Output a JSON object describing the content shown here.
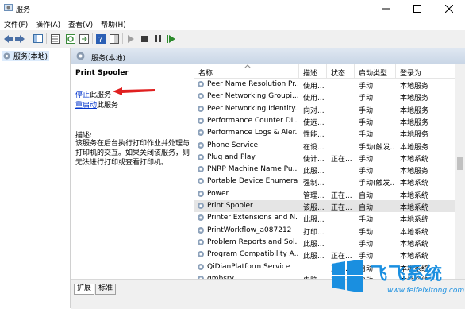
{
  "window": {
    "title": "服务"
  },
  "menu": {
    "file": "文件(F)",
    "action": "操作(A)",
    "view": "查看(V)",
    "help": "帮助(H)"
  },
  "tree": {
    "root": "服务(本地)"
  },
  "panel": {
    "header": "服务(本地)"
  },
  "detail": {
    "service_name": "Print Spooler",
    "stop_link": "停止",
    "stop_suffix": "此服务",
    "restart_link": "重启动",
    "restart_suffix": "此服务",
    "desc_label": "描述:",
    "desc_text": "该服务在后台执行打印作业并处理与打印机的交互。如果关闭该服务，则无法进行打印或查看打印机。"
  },
  "columns": {
    "name": "名称",
    "desc": "描述",
    "status": "状态",
    "startup": "启动类型",
    "logon": "登录为"
  },
  "services": [
    {
      "name": "Peer Name Resolution Pr...",
      "desc": "使用...",
      "status": "",
      "startup": "手动",
      "logon": "本地服务",
      "selected": false
    },
    {
      "name": "Peer Networking Groupi...",
      "desc": "使用...",
      "status": "",
      "startup": "手动",
      "logon": "本地服务",
      "selected": false
    },
    {
      "name": "Peer Networking Identity...",
      "desc": "向对...",
      "status": "",
      "startup": "手动",
      "logon": "本地服务",
      "selected": false
    },
    {
      "name": "Performance Counter DL...",
      "desc": "使远...",
      "status": "",
      "startup": "手动",
      "logon": "本地服务",
      "selected": false
    },
    {
      "name": "Performance Logs & Aler...",
      "desc": "性能...",
      "status": "",
      "startup": "手动",
      "logon": "本地服务",
      "selected": false
    },
    {
      "name": "Phone Service",
      "desc": "在设...",
      "status": "",
      "startup": "手动(触发...",
      "logon": "本地服务",
      "selected": false
    },
    {
      "name": "Plug and Play",
      "desc": "使计...",
      "status": "正在...",
      "startup": "手动",
      "logon": "本地系统",
      "selected": false
    },
    {
      "name": "PNRP Machine Name Pu...",
      "desc": "此服...",
      "status": "",
      "startup": "手动",
      "logon": "本地服务",
      "selected": false
    },
    {
      "name": "Portable Device Enumera...",
      "desc": "强制...",
      "status": "",
      "startup": "手动(触发...",
      "logon": "本地系统",
      "selected": false
    },
    {
      "name": "Power",
      "desc": "管理...",
      "status": "正在...",
      "startup": "自动",
      "logon": "本地系统",
      "selected": false
    },
    {
      "name": "Print Spooler",
      "desc": "该服...",
      "status": "正在...",
      "startup": "自动",
      "logon": "本地系统",
      "selected": true
    },
    {
      "name": "Printer Extensions and N...",
      "desc": "此服...",
      "status": "",
      "startup": "手动",
      "logon": "本地系统",
      "selected": false
    },
    {
      "name": "PrintWorkflow_a087212",
      "desc": "打印...",
      "status": "",
      "startup": "手动",
      "logon": "本地系统",
      "selected": false
    },
    {
      "name": "Problem Reports and Sol...",
      "desc": "此服...",
      "status": "",
      "startup": "手动",
      "logon": "本地系统",
      "selected": false
    },
    {
      "name": "Program Compatibility A...",
      "desc": "此服...",
      "status": "正在...",
      "startup": "手动",
      "logon": "本地系统",
      "selected": false
    },
    {
      "name": "QiDianPlatform Service",
      "desc": "",
      "status": "正在...",
      "startup": "自动",
      "logon": "本地系统",
      "selected": false
    },
    {
      "name": "qmbsrv",
      "desc": "电脑...",
      "status": "正在...",
      "startup": "自动",
      "logon": "本地系统",
      "selected": false
    }
  ],
  "tabs": {
    "extended": "扩展",
    "standard": "标准"
  },
  "watermark": {
    "title": "飞飞系统",
    "url": "www.feifeixitong.com"
  },
  "colors": {
    "accent": "#0078d7",
    "link": "#0033cc",
    "arrow": "#e02020",
    "watermark": "#1a8fe0"
  }
}
